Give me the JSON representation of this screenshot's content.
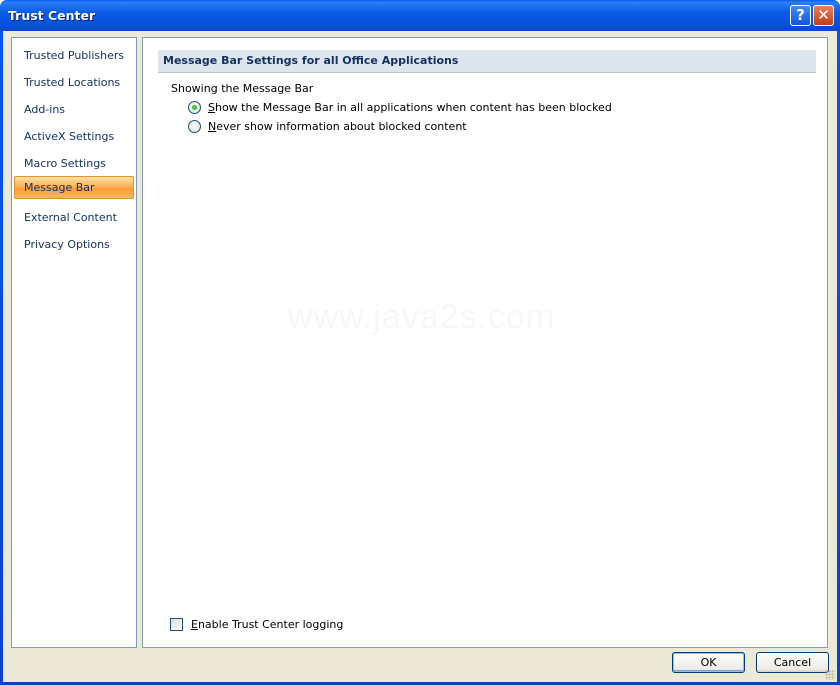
{
  "window": {
    "title": "Trust Center",
    "help_icon": "help-question-icon",
    "close_icon": "close-x-icon",
    "help_glyph": "?",
    "close_glyph": "✕"
  },
  "sidebar": {
    "items": [
      {
        "label": "Trusted Publishers",
        "selected": false
      },
      {
        "label": "Trusted Locations",
        "selected": false
      },
      {
        "label": "Add-ins",
        "selected": false
      },
      {
        "label": "ActiveX Settings",
        "selected": false
      },
      {
        "label": "Macro Settings",
        "selected": false
      },
      {
        "label": "Message Bar",
        "selected": true
      },
      {
        "label": "External Content",
        "selected": false
      },
      {
        "label": "Privacy Options",
        "selected": false
      }
    ]
  },
  "main": {
    "section_title": "Message Bar Settings for all Office Applications",
    "group_label": "Showing the Message Bar",
    "options": [
      {
        "accel": "S",
        "rest": "how the Message Bar in all applications when content has been blocked",
        "checked": true
      },
      {
        "accel": "N",
        "rest": "ever show information about blocked content",
        "checked": false
      }
    ],
    "logging": {
      "accel": "E",
      "rest": "nable Trust Center logging",
      "checked": false
    },
    "watermark": "www.java2s.com"
  },
  "buttons": {
    "ok": "OK",
    "cancel": "Cancel"
  },
  "colors": {
    "titlebar": "#0b5ce6",
    "selected_item": "#fbb35a",
    "section_header_bg": "#dde6ee",
    "nav_text": "#15305f"
  }
}
